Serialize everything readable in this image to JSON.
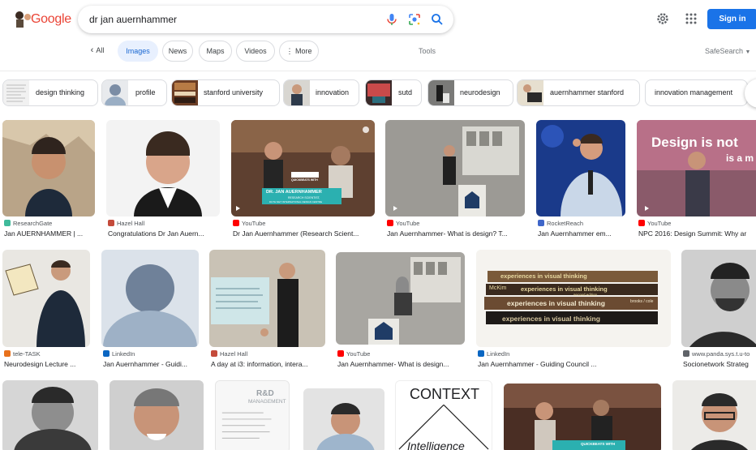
{
  "header": {
    "logo_text": "Google",
    "query": "dr jan auernhammer",
    "signin_label": "Sign in",
    "icons": [
      "mic-icon",
      "lens-icon",
      "search-icon",
      "gear-icon",
      "apps-grid-icon"
    ]
  },
  "tabs": {
    "all": "All",
    "images": "Images",
    "news": "News",
    "maps": "Maps",
    "videos": "Videos",
    "more": "More",
    "tools": "Tools",
    "safesearch": "SafeSearch"
  },
  "chips": [
    {
      "label": "design thinking"
    },
    {
      "label": "profile"
    },
    {
      "label": "stanford university"
    },
    {
      "label": "innovation"
    },
    {
      "label": "sutd"
    },
    {
      "label": "neurodesign"
    },
    {
      "label": "auernhammer stanford"
    },
    {
      "label": "innovation management"
    }
  ],
  "results": [
    {
      "source": "ResearchGate",
      "title": "Jan AUERNHAMMER | ...",
      "fav": "#40ba9b"
    },
    {
      "source": "Hazel Hall",
      "title": "Congratulations Dr Jan Auern...",
      "fav": "#c44b3b"
    },
    {
      "source": "YouTube",
      "title": "Dr Jan Auernhammer (Research Scient...",
      "fav": "#ff0000"
    },
    {
      "source": "YouTube",
      "title": "Jan Auernhammer- What is design? T...",
      "fav": "#ff0000"
    },
    {
      "source": "RocketReach",
      "title": "Jan Auernhammer em...",
      "fav": "#3f66c9"
    },
    {
      "source": "YouTube",
      "title": "NPC 2016: Design Summit: Why ar",
      "fav": "#ff0000"
    },
    {
      "source": "tele-TASK",
      "title": "Neurodesign Lecture ...",
      "fav": "#e8711c"
    },
    {
      "source": "LinkedIn",
      "title": "Jan Auernhammer - Guidi...",
      "fav": "#0a66c2"
    },
    {
      "source": "Hazel Hall",
      "title": "A day at i3: information, intera...",
      "fav": "#c44b3b"
    },
    {
      "source": "YouTube",
      "title": "Jan Auernhammer- What is design...",
      "fav": "#ff0000"
    },
    {
      "source": "LinkedIn",
      "title": "Jan Auernhammer - Guiding Council ...",
      "fav": "#0a66c2"
    },
    {
      "source": "www.panda.sys.t.u-to",
      "title": "Socionetwork Strateg",
      "fav": "#5f6368"
    }
  ],
  "thumb_text": {
    "quickbeats_with": "QUICKBEATS WITH",
    "dr_name": "DR. JAN AUERNHAMMER",
    "research_scientist": "RESEARCH SCIENTIST,",
    "design_center": "DUTH NET INTERNATIONAL DESIGN CENTRE",
    "design_is_not": "Design is not",
    "is_a": "is a m",
    "book_line": "experiences in visual thinking",
    "book_author": "McKim",
    "book_edition": "second edition",
    "book_publisher": "brooks / cole",
    "context": "CONTEXT",
    "intelligence": "Intelligence",
    "rd": "R&D",
    "management": "MANAGEMENT",
    "stanford_in_visual": "in visual"
  },
  "colors": {
    "accent": "#1a73e8",
    "active_tab_bg": "#e8f0fe",
    "active_tab_text": "#1967d2"
  }
}
